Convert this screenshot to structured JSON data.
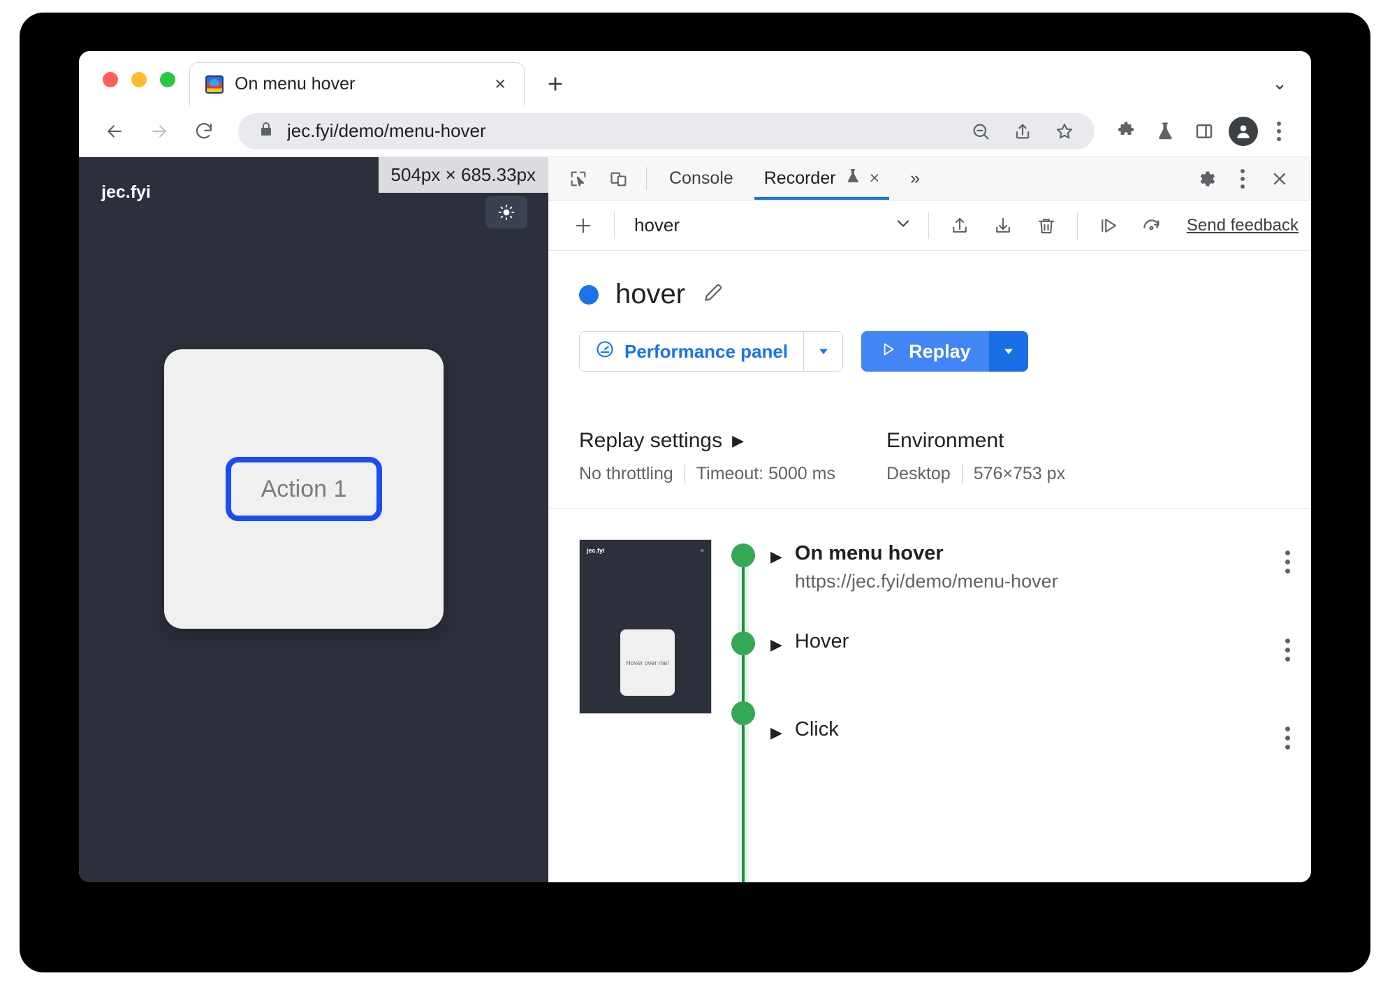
{
  "browser": {
    "traffic_lights": [
      "close",
      "minimize",
      "maximize"
    ],
    "tab": {
      "title": "On menu hover",
      "favicon": "site-favicon",
      "close_label": "×"
    },
    "new_tab_label": "+",
    "tabstrip_chevron": "⌄",
    "toolbar": {
      "back_label": "←",
      "forward_label": "→",
      "reload_label": "⟳",
      "lock_icon": "lock-icon",
      "url": "jec.fyi/demo/menu-hover",
      "zoom_out_icon": "zoom-out-icon",
      "share_icon": "share-icon",
      "bookmark_icon": "star-icon",
      "extensions_icon": "puzzle-icon",
      "experiments_icon": "flask-icon",
      "side_panel_icon": "side-panel-icon",
      "profile_icon": "avatar-icon",
      "menu_icon": "three-dot-menu-icon"
    }
  },
  "page": {
    "brand": "jec.fyi",
    "size_badge": "504px × 685.33px",
    "action_button": "Action 1",
    "theme_toggle_icon": "sun-icon"
  },
  "devtools": {
    "tabs": [
      {
        "label": "Console",
        "active": false
      },
      {
        "label": "Recorder",
        "active": true,
        "flask": "flask-icon",
        "close": "×"
      }
    ],
    "inspect_icon": "inspect-cursor-icon",
    "device_icon": "device-toolbar-icon",
    "more_tabs_label": "»",
    "settings_icon": "gear-icon",
    "more_icon": "three-dot-menu-icon",
    "close_icon": "close-icon",
    "recorder_toolbar": {
      "add_label": "+",
      "selected_recording": "hover",
      "chevron": "⌄",
      "export_icon": "export-icon",
      "import_icon": "import-icon",
      "delete_icon": "trash-icon",
      "step_replay_icon": "step-replay-icon",
      "replay_again_icon": "replay-again-icon",
      "feedback_label": "Send feedback"
    },
    "recording": {
      "title": "hover",
      "edit_icon": "pencil-icon",
      "perf_button": {
        "label": "Performance panel",
        "icon": "gauge-icon",
        "caret": "▼"
      },
      "replay_button": {
        "label": "Replay",
        "icon": "play-icon",
        "caret": "▼"
      }
    },
    "replay_settings": {
      "heading": "Replay settings",
      "caret": "▶",
      "throttling": "No throttling",
      "timeout": "Timeout: 5000 ms"
    },
    "environment": {
      "heading": "Environment",
      "device": "Desktop",
      "viewport": "576×753 px"
    },
    "thumbnail": {
      "brand": "jec.fyi",
      "close": "×",
      "card_text": "Hover over me!"
    },
    "steps": [
      {
        "caret": "▶",
        "title": "On menu hover",
        "url": "https://jec.fyi/demo/menu-hover",
        "bold": true
      },
      {
        "caret": "▶",
        "title": "Hover",
        "url": "",
        "bold": false
      },
      {
        "caret": "▶",
        "title": "Click",
        "url": "",
        "bold": false
      }
    ]
  },
  "colors": {
    "accent_blue": "#1a73e8",
    "replay_blue": "#4285f4",
    "step_green": "#34a853",
    "page_dark": "#2b303b",
    "focus_outline": "#1a4df0"
  }
}
